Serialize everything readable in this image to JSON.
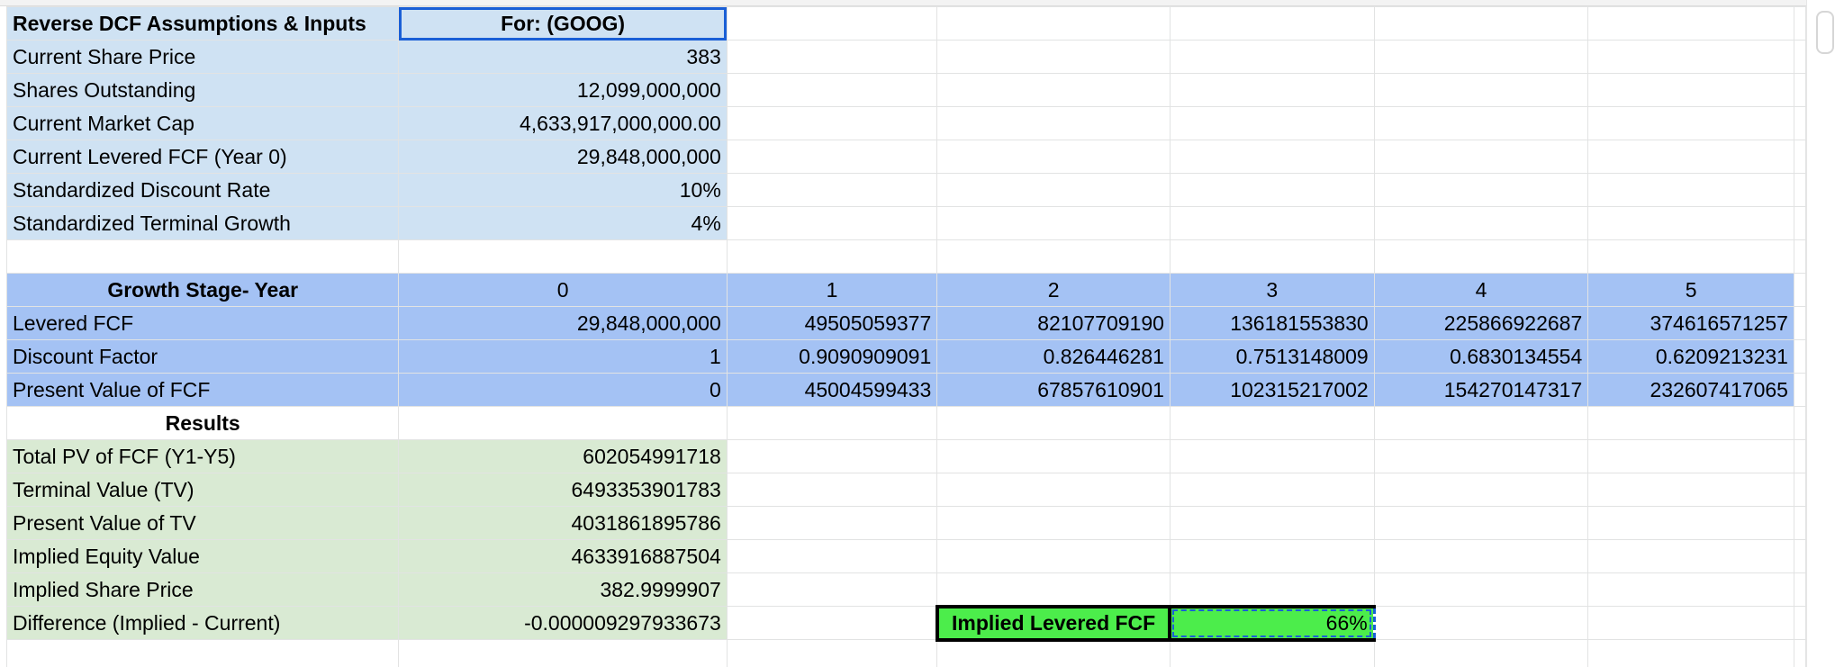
{
  "assumptions": {
    "header_label": "Reverse DCF Assumptions & Inputs",
    "header_value": "For: (GOOG)",
    "rows": [
      {
        "label": "Current Share Price",
        "value": "383"
      },
      {
        "label": "Shares Outstanding",
        "value": "12,099,000,000"
      },
      {
        "label": "Current Market Cap",
        "value": "4,633,917,000,000.00"
      },
      {
        "label": "Current Levered FCF (Year 0)",
        "value": "29,848,000,000"
      },
      {
        "label": "Standardized Discount Rate",
        "value": "10%"
      },
      {
        "label": "Standardized Terminal Growth",
        "value": "4%"
      }
    ]
  },
  "growth": {
    "header_label": "Growth Stage- Year",
    "years": [
      "0",
      "1",
      "2",
      "3",
      "4",
      "5"
    ],
    "rows": [
      {
        "label": "Levered FCF",
        "values": [
          "29,848,000,000",
          "49505059377",
          "82107709190",
          "136181553830",
          "225866922687",
          "374616571257"
        ]
      },
      {
        "label": "Discount Factor",
        "values": [
          "1",
          "0.9090909091",
          "0.826446281",
          "0.7513148009",
          "0.6830134554",
          "0.6209213231"
        ]
      },
      {
        "label": "Present Value of FCF",
        "values": [
          "0",
          "45004599433",
          "67857610901",
          "102315217002",
          "154270147317",
          "232607417065"
        ]
      }
    ]
  },
  "results": {
    "header_label": "Results",
    "rows": [
      {
        "label": "Total PV of FCF (Y1-Y5)",
        "value": "602054991718"
      },
      {
        "label": "Terminal Value (TV)",
        "value": "6493353901783"
      },
      {
        "label": "Present Value of TV",
        "value": "4031861895786"
      },
      {
        "label": "Implied Equity Value",
        "value": "4633916887504"
      },
      {
        "label": "Implied Share Price",
        "value": "382.9999907"
      },
      {
        "label": "Difference (Implied - Current)",
        "value": "-0.000009297933673"
      }
    ]
  },
  "implied": {
    "label": "Implied Levered FCF",
    "value": "66%"
  },
  "colors": {
    "assumptions_bg": "#cfe2f3",
    "growth_bg": "#a4c2f4",
    "results_bg": "#d9ead3",
    "implied_bg": "#4ced4b",
    "selection": "#1a5fd6"
  }
}
